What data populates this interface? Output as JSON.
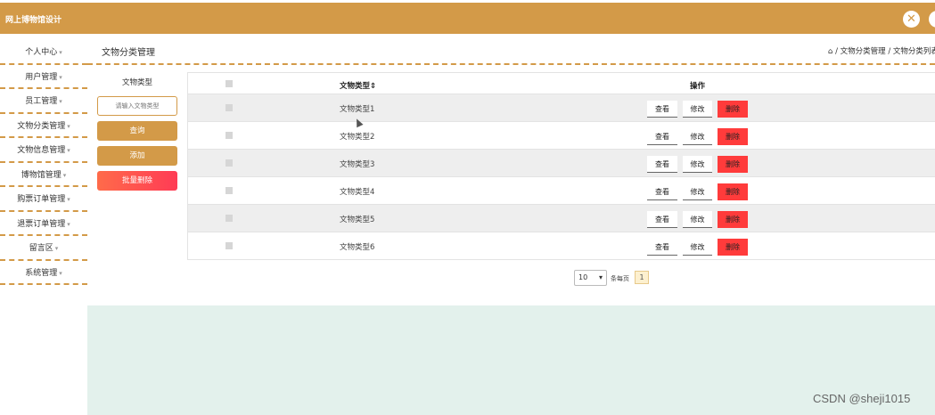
{
  "app": {
    "title": "网上博物馆设计"
  },
  "sidebar": {
    "items": [
      {
        "label": "个人中心"
      },
      {
        "label": "用户管理"
      },
      {
        "label": "员工管理"
      },
      {
        "label": "文物分类管理"
      },
      {
        "label": "文物信息管理"
      },
      {
        "label": "博物馆管理"
      },
      {
        "label": "购票订单管理"
      },
      {
        "label": "退票订单管理"
      },
      {
        "label": "留言区"
      },
      {
        "label": "系统管理"
      }
    ],
    "caret": "▾"
  },
  "header": {
    "title": "文物分类管理",
    "breadcrumb": "⌂ / 文物分类管理 / 文物分类列表"
  },
  "filter": {
    "label": "文物类型",
    "placeholder": "请输入文物类型",
    "query_label": "查询",
    "add_label": "添加",
    "batch_delete_label": "批量删除"
  },
  "table": {
    "columns": {
      "name": "文物类型",
      "sort_icon": "⇕",
      "ops": "操作"
    },
    "rows": [
      {
        "name": "文物类型1"
      },
      {
        "name": "文物类型2"
      },
      {
        "name": "文物类型3"
      },
      {
        "name": "文物类型4"
      },
      {
        "name": "文物类型5"
      },
      {
        "name": "文物类型6"
      }
    ],
    "actions": {
      "view": "查看",
      "edit": "修改",
      "delete": "删除"
    }
  },
  "pagination": {
    "page_size": "10",
    "per_page_label": "条每页",
    "current_page": "1"
  },
  "watermark": "CSDN @sheji1015",
  "colors": {
    "accent": "#d39a48",
    "danger": "#ff3b3b",
    "panel": "#e3f1ec"
  }
}
